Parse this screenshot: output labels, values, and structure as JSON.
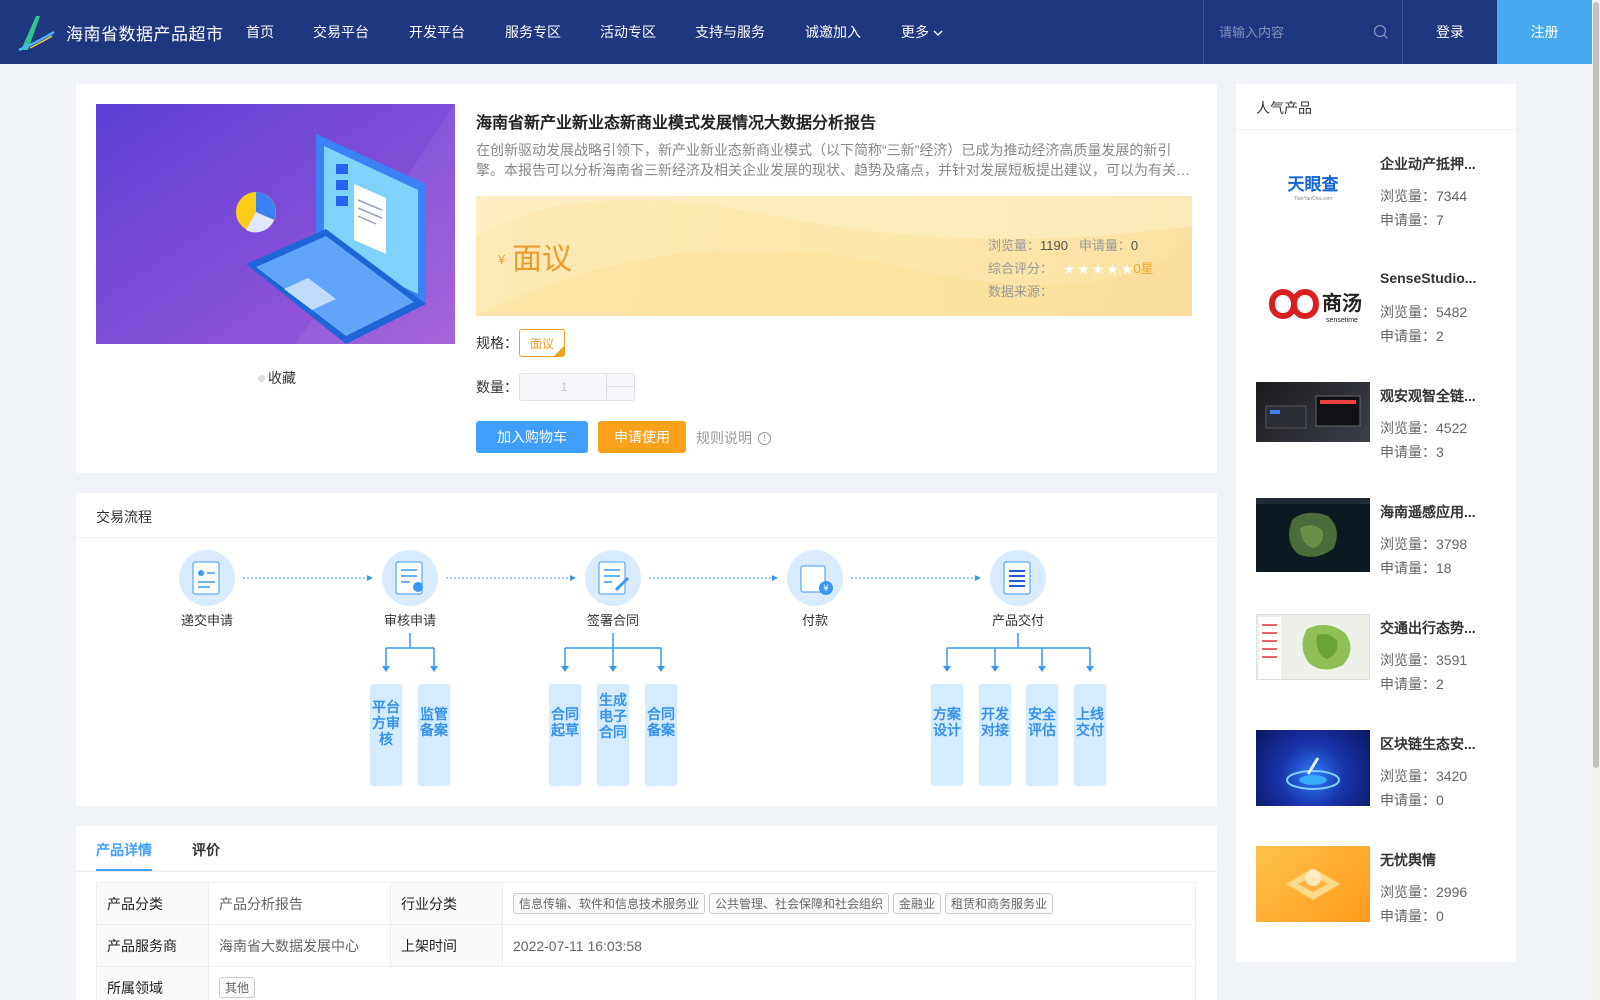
{
  "header": {
    "brand": "海南省数据产品超市",
    "nav": [
      "首页",
      "交易平台",
      "开发平台",
      "服务专区",
      "活动专区",
      "支持与服务",
      "诚邀加入",
      "更多"
    ],
    "search_placeholder": "请输入内容",
    "login": "登录",
    "register": "注册"
  },
  "product": {
    "title": "海南省新产业新业态新商业模式发展情况大数据分析报告",
    "description": "在创新驱动发展战略引领下，新产业新业态新商业模式（以下简称“三新”经济）已成为推动经济高质量发展的新引擎。本报告可以分析海南省三新经济及相关企业发展的现状、趋势及痛点，并针对发展短板提出建议，可以为有关…",
    "price_symbol": "¥",
    "price": "面议",
    "views_label": "浏览量：",
    "views": "1190",
    "applies_label": "申请量：",
    "applies": "0",
    "rating_label": "综合评分：",
    "rating": "0星",
    "rating_stars": 0,
    "source_label": "数据来源：",
    "favorite": "收藏",
    "spec_label": "规格：",
    "spec_value": "面议",
    "qty_label": "数量：",
    "qty_value": "1",
    "add_cart": "加入购物车",
    "apply": "申请使用",
    "rules": "规则说明"
  },
  "flow": {
    "title": "交易流程",
    "steps": [
      {
        "label": "递交申请",
        "icon": "application-doc-icon"
      },
      {
        "label": "审核申请",
        "icon": "review-doc-icon"
      },
      {
        "label": "签署合同",
        "icon": "sign-contract-icon"
      },
      {
        "label": "付款",
        "icon": "payment-icon"
      },
      {
        "label": "产品交付",
        "icon": "delivery-list-icon"
      }
    ],
    "sub_review": [
      "平台方审核",
      "监管备案"
    ],
    "sub_contract": [
      "合同起草",
      "生成电子合同",
      "合同备案"
    ],
    "sub_delivery": [
      "方案设计",
      "开发对接",
      "安全评估",
      "上线交付"
    ]
  },
  "details": {
    "tabs": [
      "产品详情",
      "评价"
    ],
    "category_label": "产品分类",
    "category": "产品分析报告",
    "industry_label": "行业分类",
    "industries": [
      "信息传输、软件和信息技术服务业",
      "公共管理、社会保障和社会组织",
      "金融业",
      "租赁和商务服务业"
    ],
    "provider_label": "产品服务商",
    "provider": "海南省大数据发展中心",
    "listed_label": "上架时间",
    "listed": "2022-07-11 16:03:58",
    "domain_label": "所属领域",
    "domain": "其他"
  },
  "popular": {
    "title": "人气产品",
    "views_label": "浏览量：",
    "applies_label": "申请量：",
    "items": [
      {
        "name": "企业动产抵押...",
        "views": "7344",
        "applies": "7",
        "thumb": "tianyancha-logo",
        "logo_text": "天眼查",
        "logo_sub": "TianYanCha.com"
      },
      {
        "name": "SenseStudio...",
        "views": "5482",
        "applies": "2",
        "thumb": "sensetime-logo",
        "logo_text": "商汤",
        "logo_sub": "sensetime"
      },
      {
        "name": "观安观智全链...",
        "views": "4522",
        "applies": "3",
        "thumb": "device-photo"
      },
      {
        "name": "海南遥感应用...",
        "views": "3798",
        "applies": "18",
        "thumb": "satellite-map"
      },
      {
        "name": "交通出行态势...",
        "views": "3591",
        "applies": "2",
        "thumb": "traffic-map"
      },
      {
        "name": "区块链生态安...",
        "views": "3420",
        "applies": "0",
        "thumb": "blockchain-graphic"
      },
      {
        "name": "无忧舆情",
        "views": "2996",
        "applies": "0",
        "thumb": "orange-graphic"
      }
    ]
  }
}
